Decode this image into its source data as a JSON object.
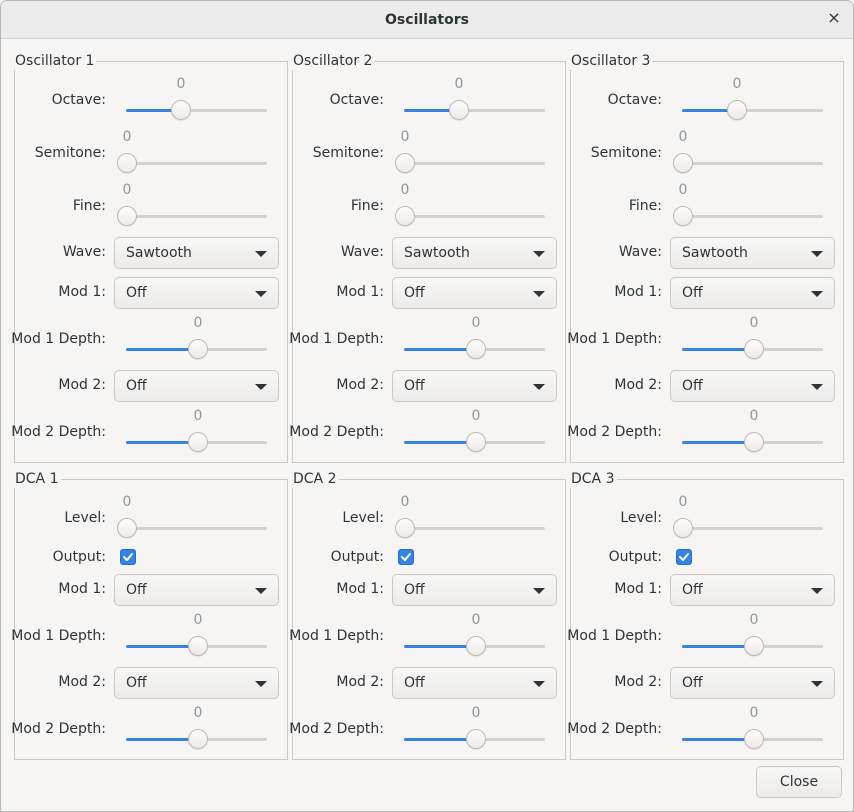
{
  "window": {
    "title": "Oscillators",
    "close_icon": "×"
  },
  "oscillators": [
    {
      "title": "Oscillator 1",
      "octave": {
        "label": "Octave:",
        "value": "0",
        "fraction": 0.38
      },
      "semitone": {
        "label": "Semitone:",
        "value": "0",
        "fraction": 0.0
      },
      "fine": {
        "label": "Fine:",
        "value": "0",
        "fraction": 0.0
      },
      "wave": {
        "label": "Wave:",
        "selected": "Sawtooth"
      },
      "mod1": {
        "label": "Mod 1:",
        "selected": "Off"
      },
      "mod1_depth": {
        "label": "Mod 1 Depth:",
        "value": "0",
        "fraction": 0.5
      },
      "mod2": {
        "label": "Mod 2:",
        "selected": "Off"
      },
      "mod2_depth": {
        "label": "Mod 2 Depth:",
        "value": "0",
        "fraction": 0.5
      }
    },
    {
      "title": "Oscillator 2",
      "octave": {
        "label": "Octave:",
        "value": "0",
        "fraction": 0.38
      },
      "semitone": {
        "label": "Semitone:",
        "value": "0",
        "fraction": 0.0
      },
      "fine": {
        "label": "Fine:",
        "value": "0",
        "fraction": 0.0
      },
      "wave": {
        "label": "Wave:",
        "selected": "Sawtooth"
      },
      "mod1": {
        "label": "Mod 1:",
        "selected": "Off"
      },
      "mod1_depth": {
        "label": "Mod 1 Depth:",
        "value": "0",
        "fraction": 0.5
      },
      "mod2": {
        "label": "Mod 2:",
        "selected": "Off"
      },
      "mod2_depth": {
        "label": "Mod 2 Depth:",
        "value": "0",
        "fraction": 0.5
      }
    },
    {
      "title": "Oscillator 3",
      "octave": {
        "label": "Octave:",
        "value": "0",
        "fraction": 0.38
      },
      "semitone": {
        "label": "Semitone:",
        "value": "0",
        "fraction": 0.0
      },
      "fine": {
        "label": "Fine:",
        "value": "0",
        "fraction": 0.0
      },
      "wave": {
        "label": "Wave:",
        "selected": "Sawtooth"
      },
      "mod1": {
        "label": "Mod 1:",
        "selected": "Off"
      },
      "mod1_depth": {
        "label": "Mod 1 Depth:",
        "value": "0",
        "fraction": 0.5
      },
      "mod2": {
        "label": "Mod 2:",
        "selected": "Off"
      },
      "mod2_depth": {
        "label": "Mod 2 Depth:",
        "value": "0",
        "fraction": 0.5
      }
    }
  ],
  "dcas": [
    {
      "title": "DCA 1",
      "level": {
        "label": "Level:",
        "value": "0",
        "fraction": 0.0
      },
      "output": {
        "label": "Output:",
        "checked": true
      },
      "mod1": {
        "label": "Mod 1:",
        "selected": "Off"
      },
      "mod1_depth": {
        "label": "Mod 1 Depth:",
        "value": "0",
        "fraction": 0.5
      },
      "mod2": {
        "label": "Mod 2:",
        "selected": "Off"
      },
      "mod2_depth": {
        "label": "Mod 2 Depth:",
        "value": "0",
        "fraction": 0.5
      }
    },
    {
      "title": "DCA 2",
      "level": {
        "label": "Level:",
        "value": "0",
        "fraction": 0.0
      },
      "output": {
        "label": "Output:",
        "checked": true
      },
      "mod1": {
        "label": "Mod 1:",
        "selected": "Off"
      },
      "mod1_depth": {
        "label": "Mod 1 Depth:",
        "value": "0",
        "fraction": 0.5
      },
      "mod2": {
        "label": "Mod 2:",
        "selected": "Off"
      },
      "mod2_depth": {
        "label": "Mod 2 Depth:",
        "value": "0",
        "fraction": 0.5
      }
    },
    {
      "title": "DCA 3",
      "level": {
        "label": "Level:",
        "value": "0",
        "fraction": 0.0
      },
      "output": {
        "label": "Output:",
        "checked": true
      },
      "mod1": {
        "label": "Mod 1:",
        "selected": "Off"
      },
      "mod1_depth": {
        "label": "Mod 1 Depth:",
        "value": "0",
        "fraction": 0.5
      },
      "mod2": {
        "label": "Mod 2:",
        "selected": "Off"
      },
      "mod2_depth": {
        "label": "Mod 2 Depth:",
        "value": "0",
        "fraction": 0.5
      }
    }
  ],
  "footer": {
    "close_label": "Close"
  },
  "colors": {
    "accent": "#3584e4",
    "window_bg": "#f6f5f4",
    "text": "#2e3436",
    "value_text": "#929595"
  }
}
